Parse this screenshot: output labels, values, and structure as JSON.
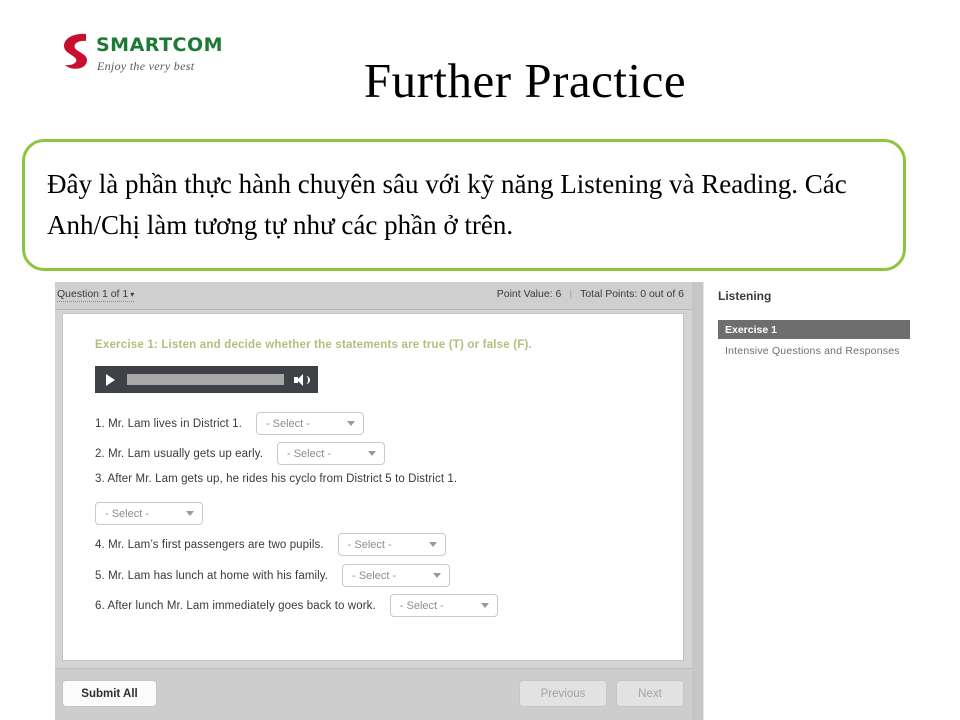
{
  "slide": {
    "logo": {
      "wordmark": "SMARTCOM",
      "tagline": "Enjoy the very best",
      "mark_color": "#c8102e",
      "word_color": "#1d7a34"
    },
    "title": "Further Practice",
    "callout": {
      "text": "Đây là phần thực hành chuyên sâu với kỹ năng Listening và Reading. Các Anh/Chị làm tương tự như các phần ở trên.",
      "border_color": "#8cc63f"
    }
  },
  "app": {
    "toolbar": {
      "question_selector": "Question 1 of 1",
      "caret": "▾",
      "point_value": "Point Value: 6",
      "divider": "|",
      "total_points": "Total Points: 0 out of 6"
    },
    "exercise": {
      "heading": "Exercise 1: Listen and decide whether the statements are true (T) or false (F).",
      "heading_color": "#b5bd7e"
    },
    "audio": {
      "play_label": "play",
      "volume_label": "volume"
    },
    "select_placeholder": "- Select -",
    "questions": [
      {
        "text": "1. Mr. Lam lives in District 1.",
        "wrapped": false
      },
      {
        "text": "2. Mr. Lam usually gets up early.",
        "wrapped": false
      },
      {
        "text": "3. After Mr. Lam gets up, he rides his cyclo from District 5 to District 1.",
        "wrapped": true
      },
      {
        "text": "4. Mr. Lam’s first passengers are two pupils.",
        "wrapped": false
      },
      {
        "text": "5. Mr. Lam has lunch at home with his family.",
        "wrapped": false
      },
      {
        "text": "6. After lunch Mr. Lam immediately goes back to work.",
        "wrapped": false
      }
    ],
    "footer": {
      "submit_all": "Submit All",
      "previous": "Previous",
      "next": "Next"
    },
    "sidebar": {
      "title": "Listening",
      "items": [
        {
          "label": "Exercise 1",
          "selected": true
        },
        {
          "label": "Intensive Questions and Responses",
          "selected": false
        }
      ]
    }
  }
}
